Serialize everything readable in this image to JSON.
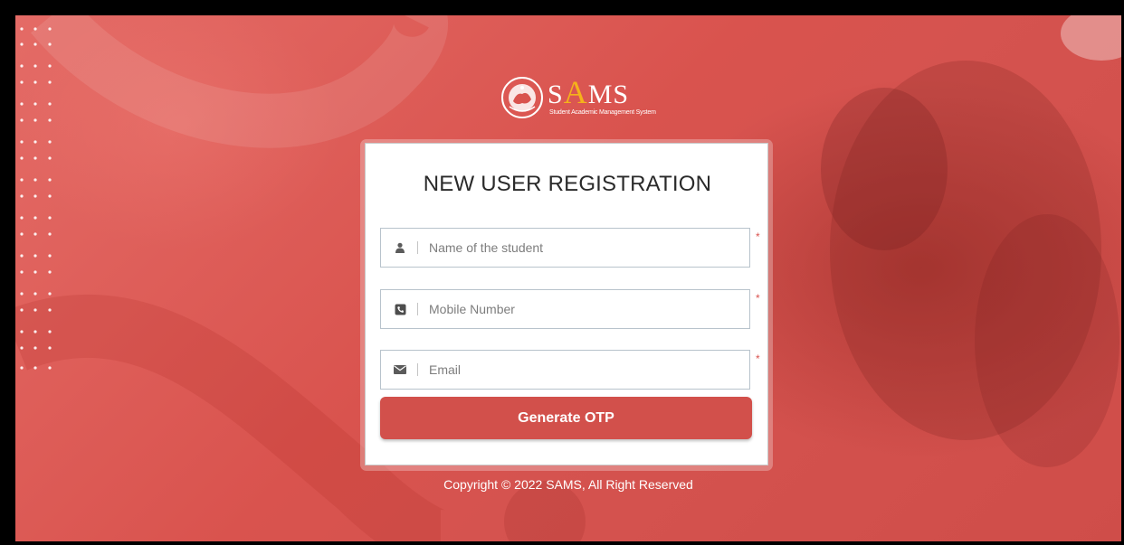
{
  "brand": {
    "name_prefix": "S",
    "name_accent": "A",
    "name_suffix": "MS",
    "subtitle": "Student Academic Management System",
    "accent_color": "#f5b21b"
  },
  "form": {
    "title": "NEW USER REGISTRATION",
    "fields": [
      {
        "icon": "user-icon",
        "placeholder": "Name of the student",
        "value": "",
        "required": "*"
      },
      {
        "icon": "phone-icon",
        "placeholder": "Mobile Number",
        "value": "",
        "required": "*"
      },
      {
        "icon": "envelope-icon",
        "placeholder": "Email",
        "value": "",
        "required": "*"
      }
    ],
    "submit_label": "Generate OTP"
  },
  "footer": {
    "text": "Copyright © 2022 SAMS, All Right Reserved"
  },
  "colors": {
    "background": "#d9534e",
    "button": "#d2504b",
    "required_marker": "#d9534f"
  }
}
